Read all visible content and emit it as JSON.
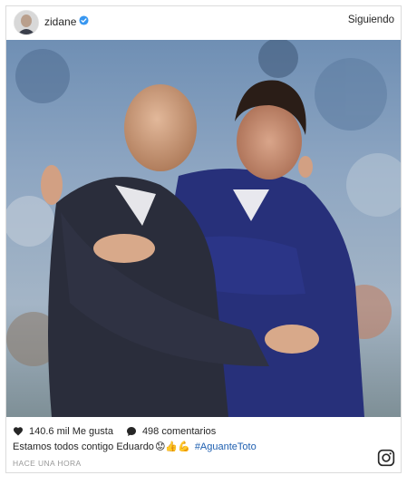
{
  "post": {
    "username": "zidane",
    "follow_label": "Siguiendo",
    "likes_text": "140.6 mil Me gusta",
    "comments_text": "498 comentarios",
    "caption_text": "Estamos todos contigo Eduardo",
    "caption_emojis": "😟👍💪",
    "hashtag": "#AguanteToto",
    "timestamp": "HACE UNA HORA"
  },
  "icons": {
    "avatar": "avatar",
    "verified": "verified-badge-icon",
    "like": "heart-icon",
    "comment": "comment-bubble-icon",
    "instagram": "instagram-logo-icon"
  },
  "colors": {
    "verified_blue": "#3897f0",
    "hashtag_blue": "#1e5fb0",
    "border": "#dbdbdb",
    "muted_text": "#999999"
  }
}
